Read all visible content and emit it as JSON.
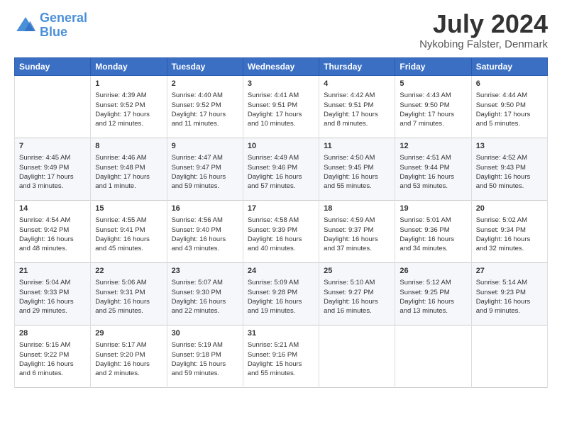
{
  "logo": {
    "line1": "General",
    "line2": "Blue"
  },
  "title": "July 2024",
  "location": "Nykobing Falster, Denmark",
  "header_days": [
    "Sunday",
    "Monday",
    "Tuesday",
    "Wednesday",
    "Thursday",
    "Friday",
    "Saturday"
  ],
  "weeks": [
    [
      {
        "day": "",
        "text": ""
      },
      {
        "day": "1",
        "text": "Sunrise: 4:39 AM\nSunset: 9:52 PM\nDaylight: 17 hours\nand 12 minutes."
      },
      {
        "day": "2",
        "text": "Sunrise: 4:40 AM\nSunset: 9:52 PM\nDaylight: 17 hours\nand 11 minutes."
      },
      {
        "day": "3",
        "text": "Sunrise: 4:41 AM\nSunset: 9:51 PM\nDaylight: 17 hours\nand 10 minutes."
      },
      {
        "day": "4",
        "text": "Sunrise: 4:42 AM\nSunset: 9:51 PM\nDaylight: 17 hours\nand 8 minutes."
      },
      {
        "day": "5",
        "text": "Sunrise: 4:43 AM\nSunset: 9:50 PM\nDaylight: 17 hours\nand 7 minutes."
      },
      {
        "day": "6",
        "text": "Sunrise: 4:44 AM\nSunset: 9:50 PM\nDaylight: 17 hours\nand 5 minutes."
      }
    ],
    [
      {
        "day": "7",
        "text": "Sunrise: 4:45 AM\nSunset: 9:49 PM\nDaylight: 17 hours\nand 3 minutes."
      },
      {
        "day": "8",
        "text": "Sunrise: 4:46 AM\nSunset: 9:48 PM\nDaylight: 17 hours\nand 1 minute."
      },
      {
        "day": "9",
        "text": "Sunrise: 4:47 AM\nSunset: 9:47 PM\nDaylight: 16 hours\nand 59 minutes."
      },
      {
        "day": "10",
        "text": "Sunrise: 4:49 AM\nSunset: 9:46 PM\nDaylight: 16 hours\nand 57 minutes."
      },
      {
        "day": "11",
        "text": "Sunrise: 4:50 AM\nSunset: 9:45 PM\nDaylight: 16 hours\nand 55 minutes."
      },
      {
        "day": "12",
        "text": "Sunrise: 4:51 AM\nSunset: 9:44 PM\nDaylight: 16 hours\nand 53 minutes."
      },
      {
        "day": "13",
        "text": "Sunrise: 4:52 AM\nSunset: 9:43 PM\nDaylight: 16 hours\nand 50 minutes."
      }
    ],
    [
      {
        "day": "14",
        "text": "Sunrise: 4:54 AM\nSunset: 9:42 PM\nDaylight: 16 hours\nand 48 minutes."
      },
      {
        "day": "15",
        "text": "Sunrise: 4:55 AM\nSunset: 9:41 PM\nDaylight: 16 hours\nand 45 minutes."
      },
      {
        "day": "16",
        "text": "Sunrise: 4:56 AM\nSunset: 9:40 PM\nDaylight: 16 hours\nand 43 minutes."
      },
      {
        "day": "17",
        "text": "Sunrise: 4:58 AM\nSunset: 9:39 PM\nDaylight: 16 hours\nand 40 minutes."
      },
      {
        "day": "18",
        "text": "Sunrise: 4:59 AM\nSunset: 9:37 PM\nDaylight: 16 hours\nand 37 minutes."
      },
      {
        "day": "19",
        "text": "Sunrise: 5:01 AM\nSunset: 9:36 PM\nDaylight: 16 hours\nand 34 minutes."
      },
      {
        "day": "20",
        "text": "Sunrise: 5:02 AM\nSunset: 9:34 PM\nDaylight: 16 hours\nand 32 minutes."
      }
    ],
    [
      {
        "day": "21",
        "text": "Sunrise: 5:04 AM\nSunset: 9:33 PM\nDaylight: 16 hours\nand 29 minutes."
      },
      {
        "day": "22",
        "text": "Sunrise: 5:06 AM\nSunset: 9:31 PM\nDaylight: 16 hours\nand 25 minutes."
      },
      {
        "day": "23",
        "text": "Sunrise: 5:07 AM\nSunset: 9:30 PM\nDaylight: 16 hours\nand 22 minutes."
      },
      {
        "day": "24",
        "text": "Sunrise: 5:09 AM\nSunset: 9:28 PM\nDaylight: 16 hours\nand 19 minutes."
      },
      {
        "day": "25",
        "text": "Sunrise: 5:10 AM\nSunset: 9:27 PM\nDaylight: 16 hours\nand 16 minutes."
      },
      {
        "day": "26",
        "text": "Sunrise: 5:12 AM\nSunset: 9:25 PM\nDaylight: 16 hours\nand 13 minutes."
      },
      {
        "day": "27",
        "text": "Sunrise: 5:14 AM\nSunset: 9:23 PM\nDaylight: 16 hours\nand 9 minutes."
      }
    ],
    [
      {
        "day": "28",
        "text": "Sunrise: 5:15 AM\nSunset: 9:22 PM\nDaylight: 16 hours\nand 6 minutes."
      },
      {
        "day": "29",
        "text": "Sunrise: 5:17 AM\nSunset: 9:20 PM\nDaylight: 16 hours\nand 2 minutes."
      },
      {
        "day": "30",
        "text": "Sunrise: 5:19 AM\nSunset: 9:18 PM\nDaylight: 15 hours\nand 59 minutes."
      },
      {
        "day": "31",
        "text": "Sunrise: 5:21 AM\nSunset: 9:16 PM\nDaylight: 15 hours\nand 55 minutes."
      },
      {
        "day": "",
        "text": ""
      },
      {
        "day": "",
        "text": ""
      },
      {
        "day": "",
        "text": ""
      }
    ]
  ]
}
